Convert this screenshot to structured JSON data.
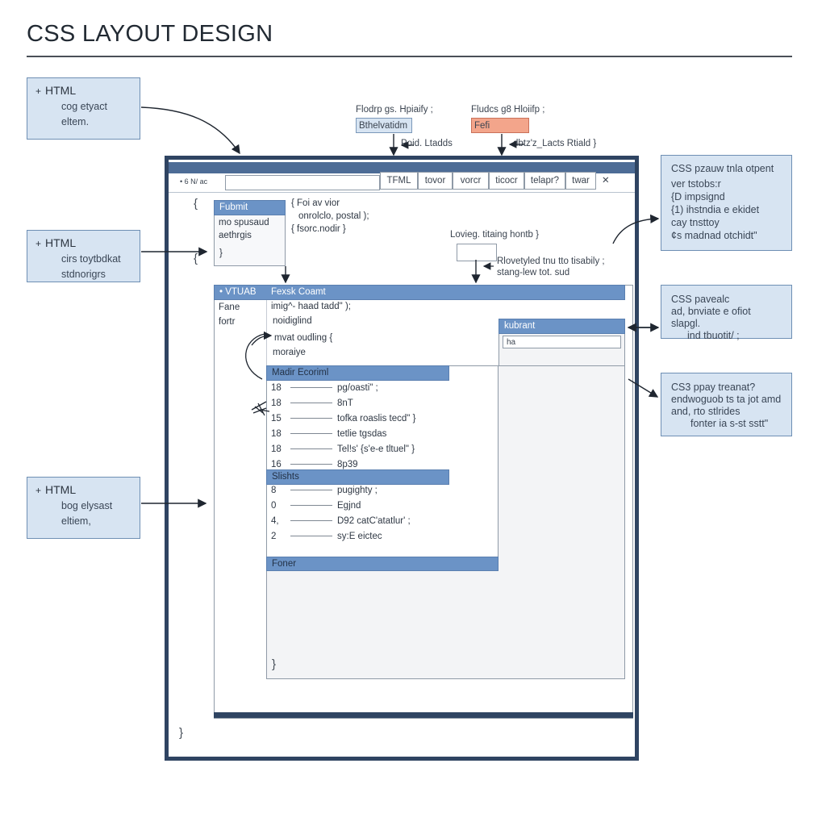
{
  "title": "CSS LAYOUT DESIGN",
  "notes_left": [
    {
      "h": "HTML",
      "l1": "cog etyact",
      "l2": "eltem."
    },
    {
      "h": "HTML",
      "l1": "cirs toytbdkat",
      "l2": "stdnorigrs"
    },
    {
      "h": "HTML",
      "l1": "bog elysast",
      "l2": "eltiem,"
    }
  ],
  "notes_right": [
    {
      "l1": "CSS pzauw tnla otpent",
      "l2": "ver tstobs:r",
      "l3": "{D  impsignd",
      "l4": "{1)  ihstndia e ekidet",
      "l5": "cay tnsttoy",
      "l6": "¢s  madnad otchidt\""
    },
    {
      "l1": "CSS pavealc",
      "l2": "ad, bnviate e ofiot slapgl.",
      "l3": "ind tbuotit/ ;"
    },
    {
      "l1": "CS3 ppay treanat?",
      "l2": "endwoguob ts ta jot amd",
      "l3": "and, rto stlrides",
      "l4": "fonter ia s-st sstt\""
    }
  ],
  "top_labels": {
    "left_caption": "Flodrp  gs. Hpiaify ;",
    "left_tag": "Bthelvatidm",
    "left_sub": "Poid. Ltadds",
    "right_caption": "Fludcs  g8  Hloiifp ;",
    "right_tag": "Fefi",
    "right_sub": "dbtz'z_Lacts Rtiald }"
  },
  "toolbar": {
    "icons_text": "• 6 N/ ac",
    "tabs": [
      "TFML",
      "tovor",
      "vorcr",
      "ticocr",
      "telapr?",
      "twar"
    ],
    "close": "✕"
  },
  "top_box": {
    "header": "Fubmit",
    "l1": "mo spusaud",
    "l2": "aethrgis",
    "close": "}"
  },
  "top_code": {
    "l1": "{ Foi av vior",
    "l2": "onrolclo, postal );",
    "l3": "{ fsorc.nodir }"
  },
  "tlabel": {
    "caption": "Lovieg. titaing hontb }",
    "l1": "Rlovetyled tnu tto tisabily ;",
    "l2": "stang-lew tot. sud"
  },
  "main": {
    "header_left": "• VTUAB",
    "header_right": "Fexsk Coamt",
    "left_col": [
      "Fane",
      "fortr"
    ],
    "code": [
      "imig^- haad tadd\" );",
      "noidiglind",
      "mvat oudling {",
      "moraiye"
    ]
  },
  "sidebar": {
    "header": "kubrant",
    "input_value": "ha"
  },
  "media": {
    "header": "Madir Ecoriml",
    "rows": [
      {
        "n": "18",
        "t": "pg/oasti\" ;"
      },
      {
        "n": "18",
        "t": "8nT"
      },
      {
        "n": "15",
        "t": "tofka  roaslis tecd\" }"
      },
      {
        "n": "18",
        "t": "tetlie  tgsdas"
      },
      {
        "n": "18",
        "t": "Tel!s'  {s'e-e tltuel\" }"
      },
      {
        "n": "16",
        "t": "8p39"
      }
    ]
  },
  "shorts": {
    "header": "Slishts",
    "rows": [
      {
        "n": "8",
        "t": "pugighty ;"
      },
      {
        "n": "0",
        "t": "Egjnd"
      },
      {
        "n": "4,",
        "t": "D92  catC'atatlur' ;"
      },
      {
        "n": "2",
        "t": "sy:E  eictec"
      }
    ]
  },
  "footer": {
    "header": "Foner"
  },
  "braces": {
    "a": "{",
    "b": "{",
    "c": "}",
    "d": "}",
    "e": "}"
  }
}
